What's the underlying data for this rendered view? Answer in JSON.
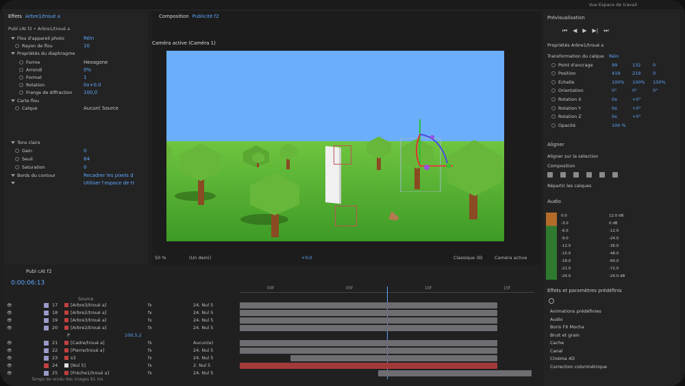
{
  "top_right": "Vue Espace de travail",
  "effects_panel": {
    "tab": "Effets",
    "tab_target": "Arbre1/troué a",
    "layer_line": "Publ cAt f2 • Arbre1/troué a",
    "rows": [
      {
        "label": "Flou d'appareil photo",
        "value": "Réin",
        "indent": 1
      },
      {
        "label": "Rayon de flou",
        "value": "10",
        "indent": 2
      },
      {
        "label": "Propriétés du diaphragme",
        "value": "",
        "indent": 1
      },
      {
        "label": "Forme",
        "value": "Hexagone",
        "indent": 3
      },
      {
        "label": "Arrondi",
        "value": "0%",
        "indent": 3
      },
      {
        "label": "Format",
        "value": "1",
        "indent": 3
      },
      {
        "label": "Rotation",
        "value": "0x+0.0",
        "indent": 3
      },
      {
        "label": "Frange de diffraction",
        "value": "100,0",
        "indent": 3
      },
      {
        "label": "Carte flou",
        "value": "",
        "indent": 1
      },
      {
        "label": "Calque",
        "value": "Aucun(     Source",
        "indent": 2
      },
      {
        "label": "Tons clairs",
        "value": "",
        "indent": 1
      },
      {
        "label": "Gain",
        "value": "0",
        "indent": 2
      },
      {
        "label": "Seuil",
        "value": "84",
        "indent": 2
      },
      {
        "label": "Saturation",
        "value": "0",
        "indent": 2
      },
      {
        "label": "Bords du contour",
        "value": "Recadrer les pixels d",
        "indent": 1
      },
      {
        "label": "",
        "value": "Utiliser l'espace de tr",
        "indent": 1
      }
    ]
  },
  "composition": {
    "tab": "Composition",
    "tab_target": "Publicité f2",
    "camera_label": "Caméra active (Caméra 1)",
    "zoom": "50 %",
    "resolution": "(Un demi)",
    "exposure": "+0,0",
    "renderer": "Classique 3D",
    "view": "Caméra active"
  },
  "timeline": {
    "comp_name": "Publ cAt f2",
    "timecode": "0:00:06:13",
    "source_col": "Source",
    "ruler_labels": [
      "00f",
      "05f",
      "10f",
      "15f"
    ],
    "layers": [
      {
        "num": "17",
        "name": "[Arbre3/troué a]",
        "color": "#9a9ac8",
        "parent": "24. Nul 5",
        "icon": "#c04040"
      },
      {
        "num": "18",
        "name": "[Arbre2/troué a]",
        "color": "#9a9ac8",
        "parent": "24. Nul 5",
        "icon": "#c04040"
      },
      {
        "num": "19",
        "name": "[Arbre3/troué a]",
        "color": "#9a9ac8",
        "parent": "24. Nul 5",
        "icon": "#c04040"
      },
      {
        "num": "20",
        "name": "[Arbre2/troué a]",
        "color": "#9a9ac8",
        "parent": "24. Nul 5",
        "icon": "#c04040"
      },
      {
        "num": "21",
        "name": "[Cadre/troué a]",
        "color": "#9a9ac8",
        "parent": "Aucun(e)",
        "icon": "#c04040"
      },
      {
        "num": "22",
        "name": "[Pierre/troué a]",
        "color": "#9a9ac8",
        "parent": "24. Nul 5",
        "icon": "#c04040"
      },
      {
        "num": "23",
        "name": "s3",
        "color": "#9a9ac8",
        "parent": "24. Nul 5",
        "icon": "#c04040"
      },
      {
        "num": "24",
        "name": "[Nul 5]",
        "color": "#c24040",
        "parent": "2. Nul 5",
        "icon": "#e0e0e0"
      },
      {
        "num": "25",
        "name": "[Frèche1/troué a]",
        "color": "#9a9ac8",
        "parent": "24. Nul 5",
        "icon": "#c04040"
      }
    ],
    "sub_row": {
      "prop": "P",
      "value": "100,5,2"
    },
    "footer": "Temps de rendu des images 81 ms"
  },
  "right_panel": {
    "preview": "Prévisualisation",
    "properties_title": "Propriétés Arbre1/troué a",
    "transform": "Transformation du calque",
    "reset": "Réin",
    "props": [
      {
        "label": "Point d'ancrage",
        "v1": "99",
        "v2": "132",
        "v3": "0"
      },
      {
        "label": "Position",
        "v1": "419",
        "v2": "219",
        "v3": "0"
      },
      {
        "label": "Echelle",
        "v1": "100%",
        "v2": "100%",
        "v3": "100%"
      },
      {
        "label": "Orientation",
        "v1": "0°",
        "v2": "0°",
        "v3": "0°"
      },
      {
        "label": "Rotation X",
        "v1": "0x",
        "v2": "+0°",
        "v3": ""
      },
      {
        "label": "Rotation Y",
        "v1": "0x",
        "v2": "+0°",
        "v3": ""
      },
      {
        "label": "Rotation Z",
        "v1": "0x",
        "v2": "+0°",
        "v3": ""
      },
      {
        "label": "Opacité",
        "v1": "100 %",
        "v2": "",
        "v3": ""
      }
    ],
    "align_title": "Aligner",
    "align_to": "Aligner sur la sélection",
    "distribute": "Composition",
    "distribute2": "Répartir les calques",
    "audio_title": "Audio",
    "audio_left": [
      "0.0",
      "-3.0",
      "-6.0",
      "-9.0",
      "-12.0",
      "-15.0",
      "-18.0",
      "-21.0",
      "-24.0"
    ],
    "audio_right": [
      "12.0 dB",
      "0 dB",
      "-12.0",
      "-24.0",
      "-36.0",
      "-48.0",
      "-60.0",
      "-72.0",
      "-24.0 dB"
    ],
    "effects_title": "Effets et paramètres prédéfinis",
    "effects_items": [
      "Animations prédéfinies",
      "Audio",
      "Boris FX Mocha",
      "Bruit et grain",
      "Cache",
      "Canal",
      "Cinéma 4D",
      "Correction colorimétrique"
    ]
  },
  "colors": {
    "accent": "#5fa8ff",
    "sky": "#6aaefc",
    "grass": "#5fb535",
    "layer_red": "#a33a3a"
  }
}
